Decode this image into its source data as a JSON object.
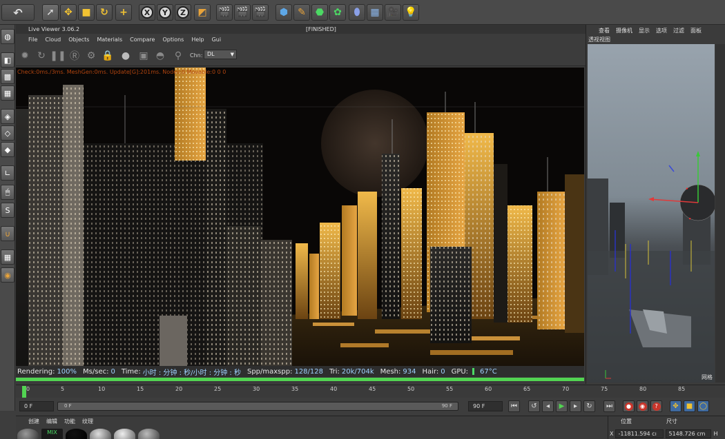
{
  "toolbar": {
    "undo_icon": "undo-icon",
    "axis_x": "X",
    "axis_y": "Y",
    "axis_z": "Z"
  },
  "live_viewer": {
    "title": "Live Viewer 3.06.2",
    "status_title": "[FINISHED]",
    "menu": [
      "File",
      "Cloud",
      "Objects",
      "Materials",
      "Compare",
      "Options",
      "Help",
      "Gui"
    ],
    "channel_label": "Chn:",
    "channel_value": "DL",
    "check_line": "Check:0ms./3ms. MeshGen:0ms. Update[G]:201ms. Nodes:0 Movable:0  0 0",
    "status": {
      "rendering_label": "Rendering:",
      "rendering_value": "100%",
      "ms_label": "Ms/sec:",
      "ms_value": "0",
      "time_label": "Time:",
      "time_value": "小时 : 分钟 : 秒/小时 : 分钟 : 秒",
      "spp_label": "Spp/maxspp:",
      "spp_value": "128/128",
      "tri_label": "Tri:",
      "tri_value": "20k/704k",
      "mesh_label": "Mesh:",
      "mesh_value": "934",
      "hair_label": "Hair:",
      "hair_value": "0",
      "gpu_label": "GPU:",
      "gpu_temp": "67°C"
    },
    "progress": 1.0
  },
  "right_panel": {
    "menu": [
      "查看",
      "摄像机",
      "显示",
      "选项",
      "过滤",
      "面板"
    ],
    "view_label": "透视视图",
    "corner_label": "网格"
  },
  "timeline": {
    "ticks": [
      "0",
      "5",
      "10",
      "15",
      "20",
      "25",
      "30",
      "35",
      "40",
      "45",
      "50",
      "55",
      "60",
      "65",
      "70",
      "75",
      "80",
      "85"
    ],
    "current_frame": "0 F",
    "range_start": "0 F",
    "range_end_inner": "90 F",
    "range_end": "90 F"
  },
  "material_panel": {
    "menu": [
      "创建",
      "编辑",
      "功能",
      "纹理"
    ],
    "mix_label": "MIX"
  },
  "coord_panel": {
    "position_label": "位置",
    "size_label": "尺寸",
    "x_label": "X",
    "x_value": "-11811.594 cı",
    "size_x_value": "5148.726 cm",
    "h_label": "H"
  },
  "colors": {
    "accent_green": "#52d452",
    "icon_yellow": "#f1c232",
    "render_orange": "#e0a23a"
  }
}
